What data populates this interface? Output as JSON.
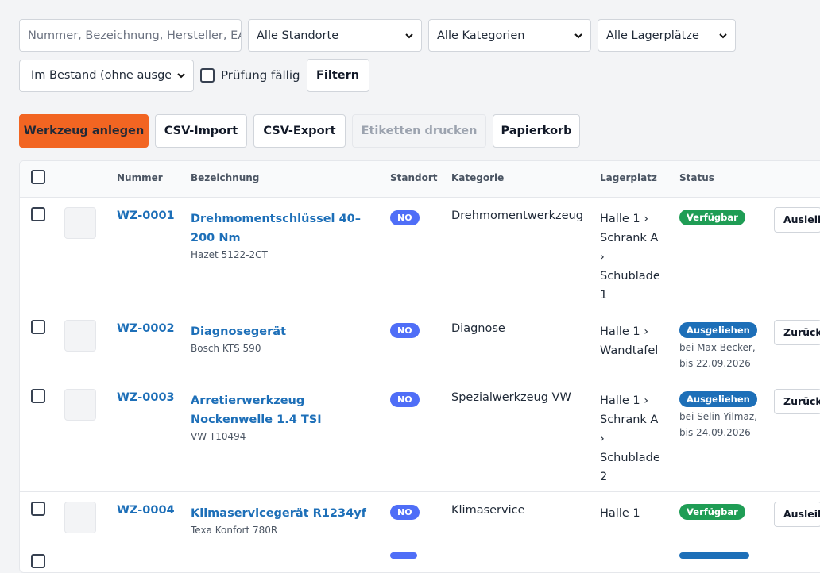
{
  "filters": {
    "search_placeholder": "Nummer, Bezeichnung, Hersteller, EAN …",
    "location_select": "Alle Standorte",
    "category_select": "Alle Kategorien",
    "storage_select": "Alle Lagerplätze",
    "stock_select": "Im Bestand (ohne ausgemustert)",
    "inspection_due_label": "Prüfung fällig",
    "filter_button": "Filtern"
  },
  "actions": {
    "create": "Werkzeug anlegen",
    "csv_import": "CSV-Import",
    "csv_export": "CSV-Export",
    "print_labels": "Etiketten drucken",
    "trash": "Papierkorb"
  },
  "table": {
    "headers": {
      "number": "Nummer",
      "name": "Bezeichnung",
      "location": "Standort",
      "category": "Kategorie",
      "storage": "Lagerplatz",
      "status": "Status"
    },
    "rows": [
      {
        "number": "WZ-0001",
        "name": "Drehmomentschlüssel 40–200 Nm",
        "maker": "Hazet 5122-2CT",
        "location": "NO",
        "category": "Drehmomentwerkzeug",
        "storage": "Halle 1 › Schrank A › Schublade 1",
        "status": "Verfügbar",
        "status_note": "",
        "action": "Ausleihen"
      },
      {
        "number": "WZ-0002",
        "name": "Diagnosegerät",
        "maker": "Bosch KTS 590",
        "location": "NO",
        "category": "Diagnose",
        "storage": "Halle 1 › Wandtafel",
        "status": "Ausgeliehen",
        "status_note": "bei Max Becker, bis 22.09.2026",
        "action": "Zurückgeben"
      },
      {
        "number": "WZ-0003",
        "name": "Arretierwerkzeug Nockenwelle 1.4 TSI",
        "maker": "VW T10494",
        "location": "NO",
        "category": "Spezialwerkzeug VW",
        "storage": "Halle 1 › Schrank A › Schublade 2",
        "status": "Ausgeliehen",
        "status_note": "bei Selin Yilmaz, bis 24.09.2026",
        "action": "Zurückgeben"
      },
      {
        "number": "WZ-0004",
        "name": "Klimaservicegerät R1234yf",
        "maker": "Texa Konfort 780R",
        "location": "NO",
        "category": "Klimaservice",
        "storage": "Halle 1",
        "status": "Verfügbar",
        "status_note": "",
        "action": "Ausleihen"
      }
    ]
  }
}
